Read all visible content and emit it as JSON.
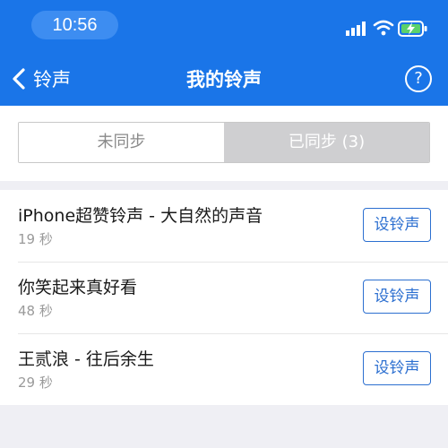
{
  "status_bar": {
    "time": "10:56"
  },
  "nav": {
    "back_label": "铃声",
    "title": "我的铃声",
    "help_symbol": "?"
  },
  "segments": [
    {
      "label": "未同步",
      "selected": false
    },
    {
      "label": "已同步 (3)",
      "selected": true
    }
  ],
  "ringtones": [
    {
      "title": "iPhone超赞铃声 - 大自然的声音",
      "duration": "19 秒",
      "action": "设铃声"
    },
    {
      "title": "你笑起来真好看",
      "duration": "48 秒",
      "action": "设铃声"
    },
    {
      "title": "王贰浪 - 往后余生",
      "duration": "29 秒",
      "action": "设铃声"
    }
  ],
  "colors": {
    "header": "#1a75e8",
    "accent_button": "#2c6fd0",
    "selected_segment": "#cfcfd1",
    "page_background": "#efeff4"
  },
  "icons": {
    "signal": "cellular-signal-icon",
    "wifi": "wifi-icon",
    "battery": "battery-charging-icon",
    "back": "chevron-left-icon",
    "help": "help-icon"
  }
}
